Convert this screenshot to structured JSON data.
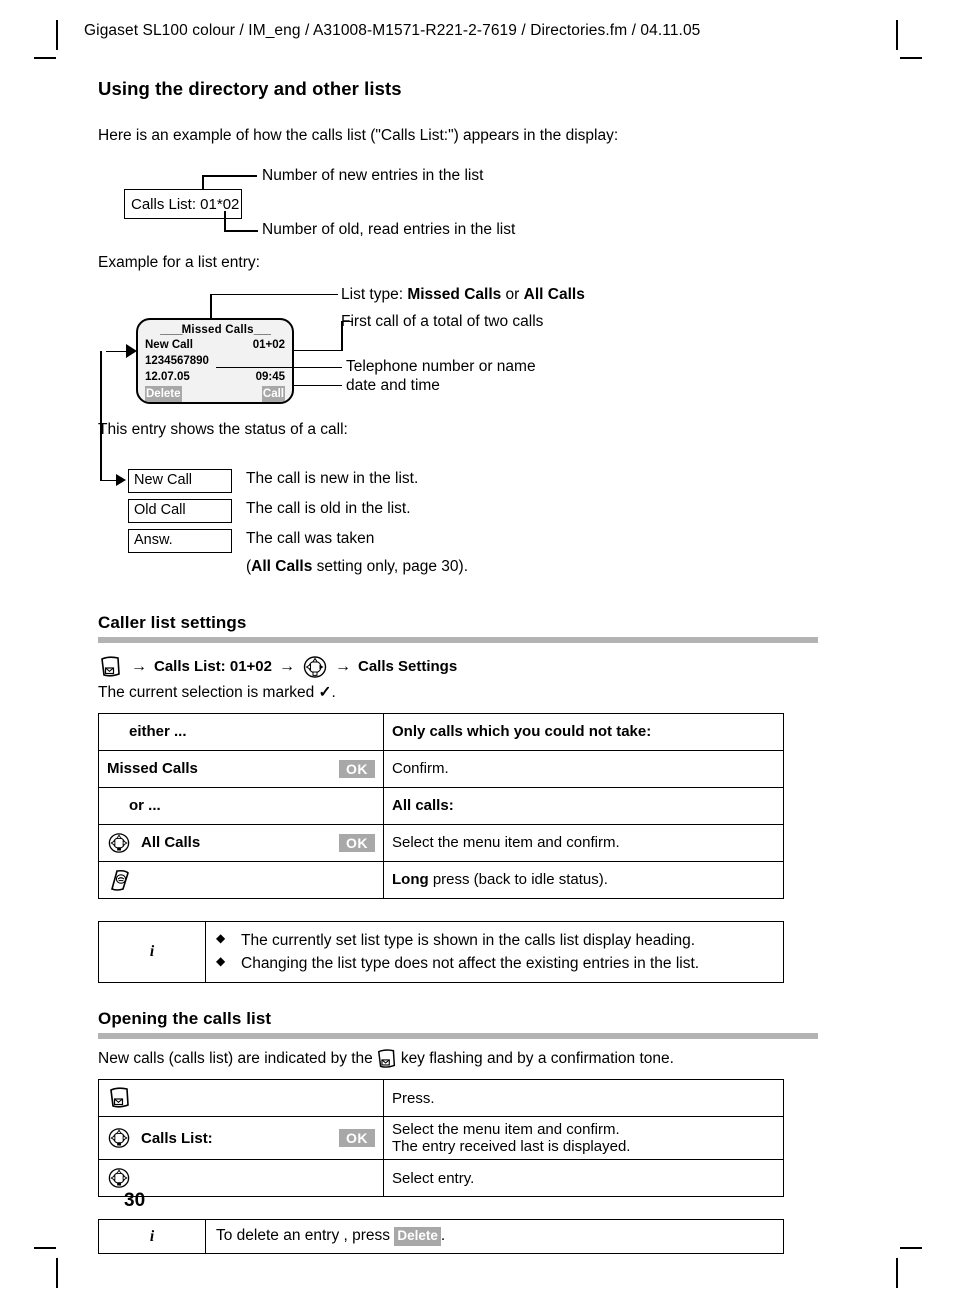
{
  "header": {
    "text": "Gigaset SL100 colour / IM_eng / A31008-M1571-R221-2-7619 / Directories.fm / 04.11.05"
  },
  "section": {
    "title": "Using the directory and other lists",
    "intro": "Here is an example of how the calls list (\"Calls List:\") appears in the display:",
    "example_label": "Example for a list entry:",
    "status_intro": "This entry shows the status of a call:"
  },
  "calls_list_diagram": {
    "box_label": "Calls List: 01*02",
    "annotation_new": "Number of new entries in the list",
    "annotation_old": "Number of old, read entries in the list"
  },
  "display": {
    "title": "Missed Calls",
    "status": "New Call",
    "counter": "01+02",
    "number": "1234567890",
    "date": "12.07.05",
    "time": "09:45",
    "softkey_left": "Delete",
    "softkey_right": "Call",
    "annotations": {
      "list_type_prefix": "List type: ",
      "list_type_a": "Missed Calls",
      "list_type_mid": " or ",
      "list_type_b": "All Calls",
      "first_call": "First call  of a total of two calls",
      "number_or_name": "Telephone number or name",
      "date_and_time": "date and time"
    }
  },
  "status_rows": [
    {
      "box": "New Call",
      "desc": "The call is new in the list."
    },
    {
      "box": "Old Call",
      "desc": "The call is old in the list."
    },
    {
      "box": "Answ.",
      "desc": "The call was taken"
    }
  ],
  "status_note": {
    "open": "(",
    "bold": "All Calls",
    "rest": " setting only, page 30)."
  },
  "caller_list_settings": {
    "heading": "Caller list settings",
    "path": {
      "step1": "Calls List:  01+02",
      "step2": "Calls Settings",
      "arrow": "→"
    },
    "marked_text_a": "The current selection is marked ",
    "marked_text_b": "."
  },
  "settings_table": {
    "rows": [
      {
        "left": "either ...",
        "left_bold": true,
        "left_indent": true,
        "icon": "none",
        "ok": "",
        "right": "Only calls which you could not take:",
        "right_bold": true
      },
      {
        "left": "Missed Calls",
        "left_bold": true,
        "left_indent": false,
        "icon": "none",
        "ok": "OK",
        "right": "Confirm.",
        "right_bold": false
      },
      {
        "left": "or ...",
        "left_bold": true,
        "left_indent": true,
        "icon": "none",
        "ok": "",
        "right": "All calls:",
        "right_bold": true
      },
      {
        "left": "All Calls",
        "left_bold": true,
        "left_indent": false,
        "icon": "nav-key",
        "ok": "OK",
        "right": "Select the menu item and confirm.",
        "right_bold": false
      },
      {
        "left": "",
        "left_bold": false,
        "left_indent": false,
        "icon": "end-call-key",
        "ok": "",
        "right_rich": {
          "bold": "Long",
          "rest": " press (back to idle status)."
        }
      }
    ]
  },
  "info_box_1": {
    "icon": "i",
    "bullets": [
      "The currently set list type is shown in the calls list display heading.",
      "Changing the list type does not affect the existing entries in the list."
    ]
  },
  "opening_calls_list": {
    "heading": "Opening the calls list",
    "intro_a": "New calls (calls list) are indicated by the ",
    "intro_b": " key flashing and by a confirmation tone.",
    "rows": [
      {
        "left": "",
        "icon": "message-key",
        "ok": "",
        "right_line1": "Press.",
        "right_line2": ""
      },
      {
        "left": "Calls List:",
        "icon": "nav-key",
        "ok": "OK",
        "right_line1": "Select the menu item and confirm.",
        "right_line2": "The entry received last is displayed."
      },
      {
        "left": "",
        "icon": "nav-key",
        "ok": "",
        "right_line1": "Select entry.",
        "right_line2": ""
      }
    ]
  },
  "info_box_2": {
    "icon": "i",
    "text_a": "To delete an entry , press ",
    "badge": "Delete",
    "text_b": "."
  },
  "page_number": "30",
  "colors": {
    "rule": "#b3b3b3",
    "softkey_bg": "#a8a8a8",
    "lcd_bg": "#f2f2f2",
    "ink": "#000000"
  }
}
